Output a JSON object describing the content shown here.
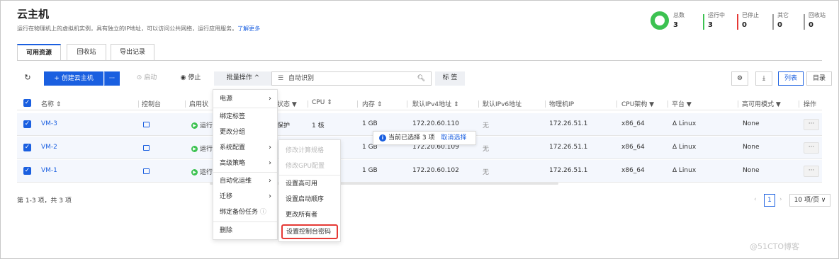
{
  "header": {
    "title": "云主机",
    "description": "运行在物理机上的虚拟机实例，具有独立的IP地址，可以访问公共网络，运行应用服务。",
    "learn_more": "了解更多"
  },
  "stats": {
    "total_label": "总数",
    "total_value": "3",
    "running_label": "运行中",
    "running_value": "3",
    "stopped_label": "已停止",
    "stopped_value": "0",
    "other_label": "其它",
    "other_value": "0",
    "recycle_label": "回收站",
    "recycle_value": "0",
    "colors": {
      "running": "#3cc251",
      "stopped": "#e53935",
      "neutral": "#9e9e9e"
    }
  },
  "tabs": [
    "可用资源",
    "回收站",
    "导出记录"
  ],
  "toolbar": {
    "refresh_icon": "refresh-icon",
    "create_label": "+ 创建云主机",
    "more_label": "···",
    "start_label": "启动",
    "stop_label": "停止",
    "batch_label": "批量操作 ^",
    "search_placeholder": "自动识别",
    "tag_label": "标 签",
    "list_view": "列表",
    "card_view": "目录"
  },
  "table": {
    "headers": {
      "name": "名称 ⇕",
      "console": "控制台",
      "enable_state": "启用状",
      "state": "状态 ▼",
      "cpu": "CPU ⇕",
      "memory": "内存 ⇕",
      "ipv4": "默认IPv4地址 ⇕",
      "ipv6": "默认IPv6地址",
      "physical_ip": "物理机IP",
      "cpu_arch": "CPU架构 ▼",
      "platform": "平台 ▼",
      "ha_mode": "高可用模式 ▼",
      "actions": "操作"
    },
    "rows": [
      {
        "name": "VM-3",
        "enable": "运行",
        "state": "保护",
        "cpu": "1 核",
        "memory": "1 GB",
        "ipv4": "172.20.60.110",
        "ipv6": "无",
        "physical_ip": "172.26.51.1",
        "arch": "x86_64",
        "platform": "Linux",
        "ha": "None"
      },
      {
        "name": "VM-2",
        "enable": "运行",
        "state": "",
        "cpu": "",
        "memory": "1 GB",
        "ipv4": "172.20.60.109",
        "ipv6": "无",
        "physical_ip": "172.26.51.1",
        "arch": "x86_64",
        "platform": "Linux",
        "ha": "None"
      },
      {
        "name": "VM-1",
        "enable": "运行",
        "state": "",
        "cpu": "",
        "memory": "1 GB",
        "ipv4": "172.20.60.102",
        "ipv6": "无",
        "physical_ip": "172.26.51.1",
        "arch": "x86_64",
        "platform": "Linux",
        "ha": "None"
      }
    ]
  },
  "selection_tip": {
    "text": "当前已选择 3 项",
    "cancel": "取消选择"
  },
  "batch_menu": {
    "items": [
      "电源",
      "绑定标签",
      "更改分组",
      "系统配置",
      "高级策略",
      "自动化运维",
      "迁移",
      "绑定备份任务",
      "删除"
    ]
  },
  "sub_menu": {
    "items": [
      "修改计算规格",
      "修改GPU配置",
      "设置高可用",
      "设置启动顺序",
      "更改所有者",
      "设置控制台密码"
    ]
  },
  "footer": {
    "summary": "第 1-3 项，共 3 项",
    "page": "1",
    "page_size": "10 项/页 ∨"
  },
  "watermark": "@51CTO博客"
}
